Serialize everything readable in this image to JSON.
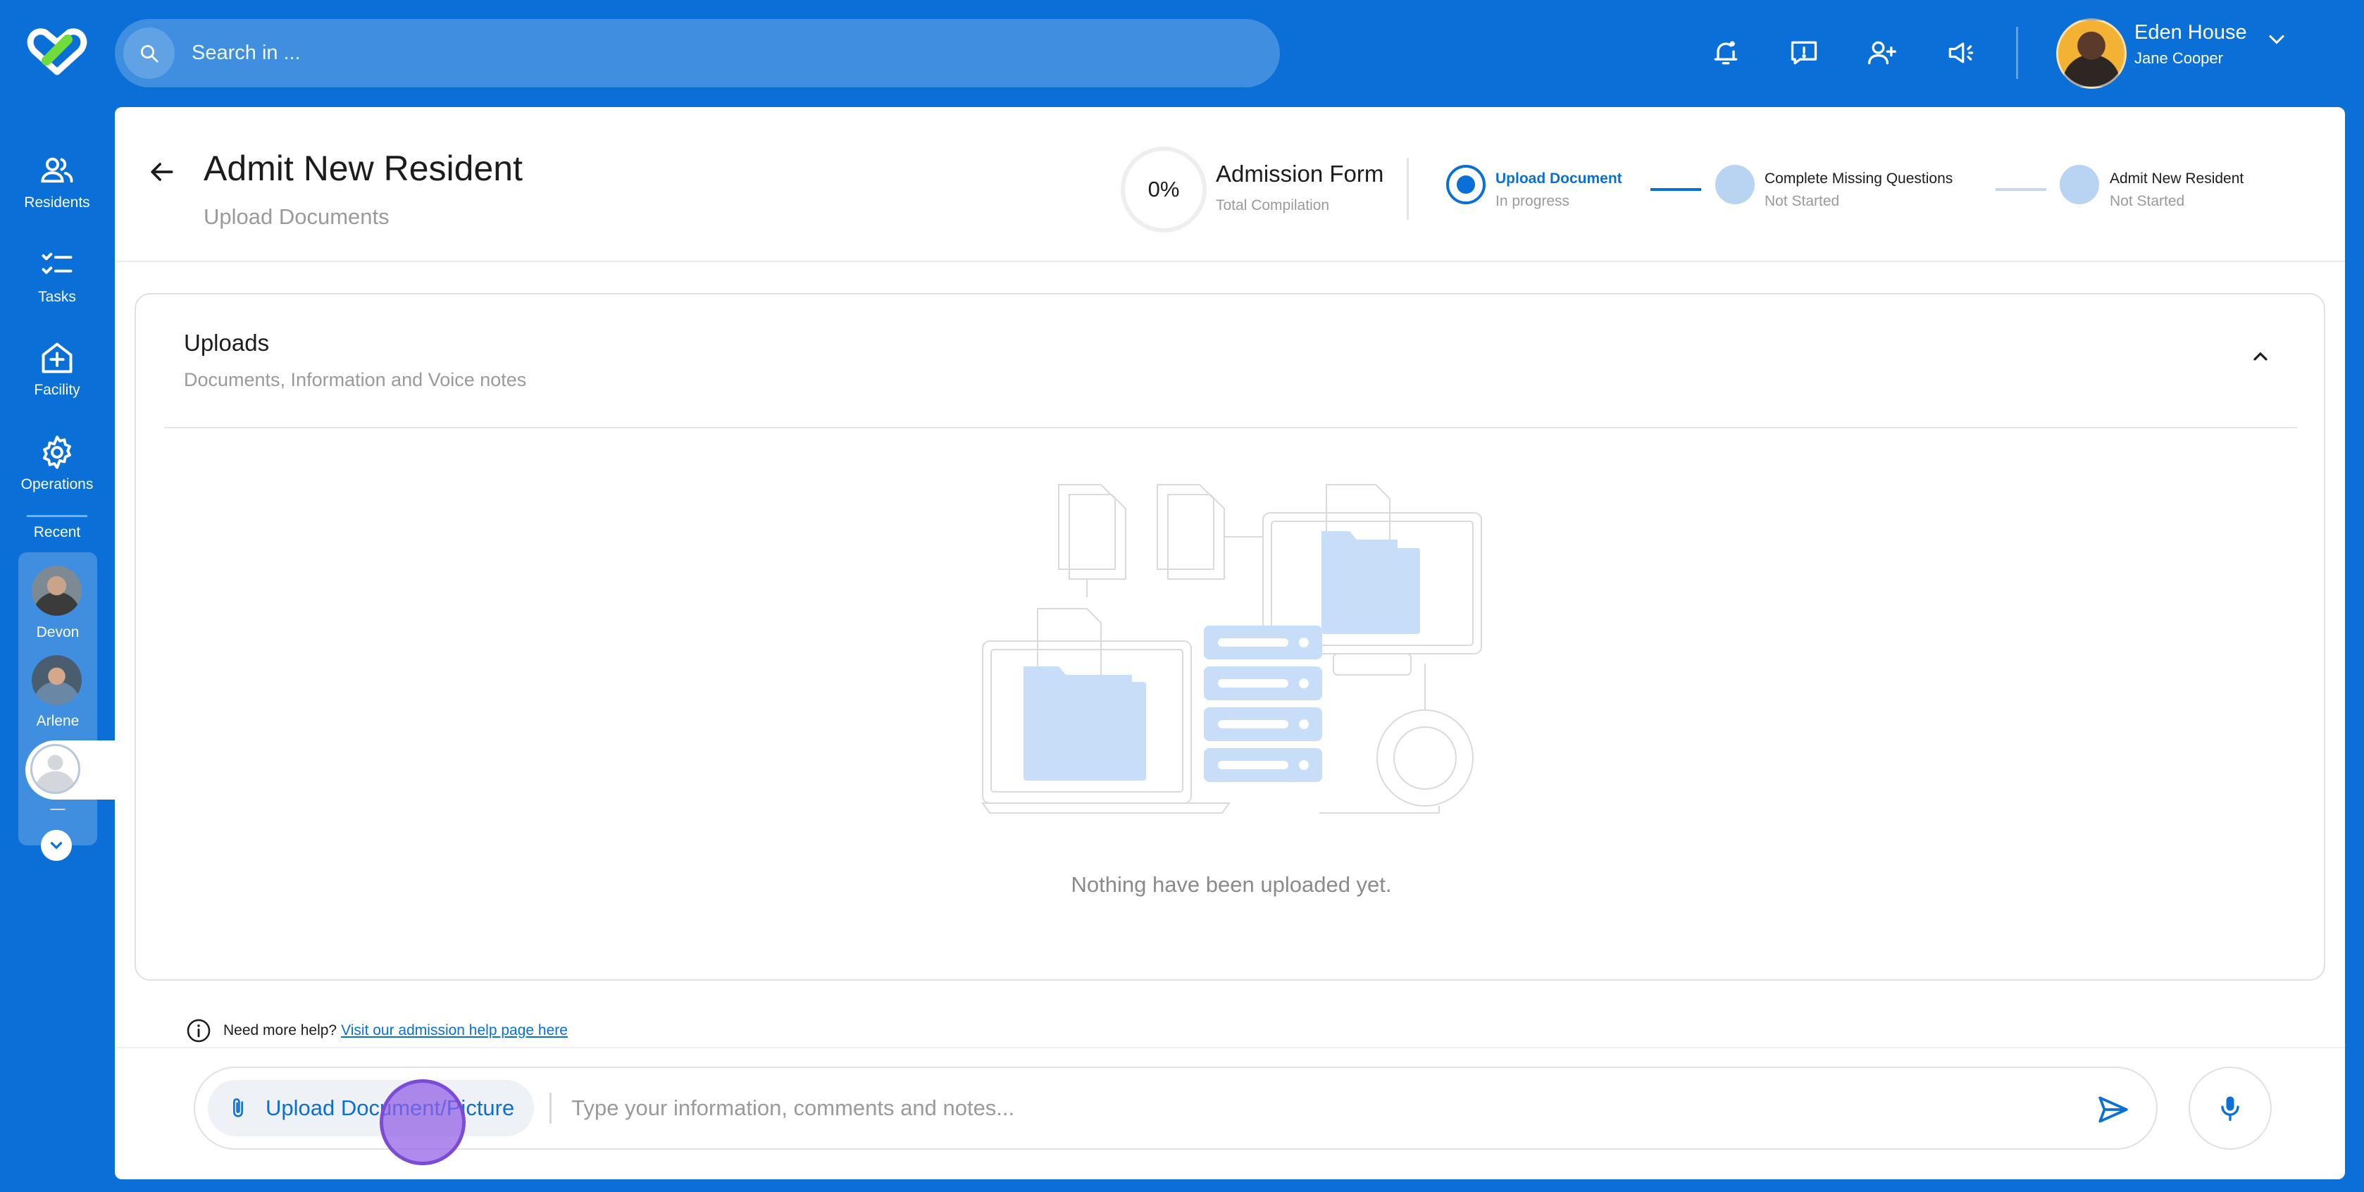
{
  "search": {
    "placeholder": "Search in ..."
  },
  "user": {
    "facility": "Eden House",
    "name": "Jane Cooper"
  },
  "sidebar": {
    "items": [
      {
        "label": "Residents"
      },
      {
        "label": "Tasks"
      },
      {
        "label": "Facility"
      },
      {
        "label": "Operations"
      }
    ],
    "recent_label": "Recent",
    "recent": [
      {
        "name": "Devon"
      },
      {
        "name": "Arlene"
      },
      {
        "name": "—"
      }
    ]
  },
  "header": {
    "title": "Admit New Resident",
    "subtitle": "Upload Documents",
    "progress": {
      "value_label": "0%",
      "value": 0
    },
    "form_title": "Admission Form",
    "form_subtitle": "Total Compilation",
    "steps": [
      {
        "title": "Upload Document",
        "status": "In progress"
      },
      {
        "title": "Complete Missing Questions",
        "status": "Not Started"
      },
      {
        "title": "Admit New Resident",
        "status": "Not Started"
      }
    ]
  },
  "uploads": {
    "title": "Uploads",
    "subtitle": "Documents, Information and Voice notes",
    "empty_text": "Nothing have been uploaded yet."
  },
  "help": {
    "text": "Need more help?",
    "link": "Visit our admission help page here"
  },
  "composer": {
    "upload_label": "Upload Document/Picture",
    "placeholder": "Type your information, comments and notes..."
  },
  "colors": {
    "primary": "#0a6fd6",
    "step_inactive": "#b9d3f2",
    "cursor": "#925ee6"
  }
}
